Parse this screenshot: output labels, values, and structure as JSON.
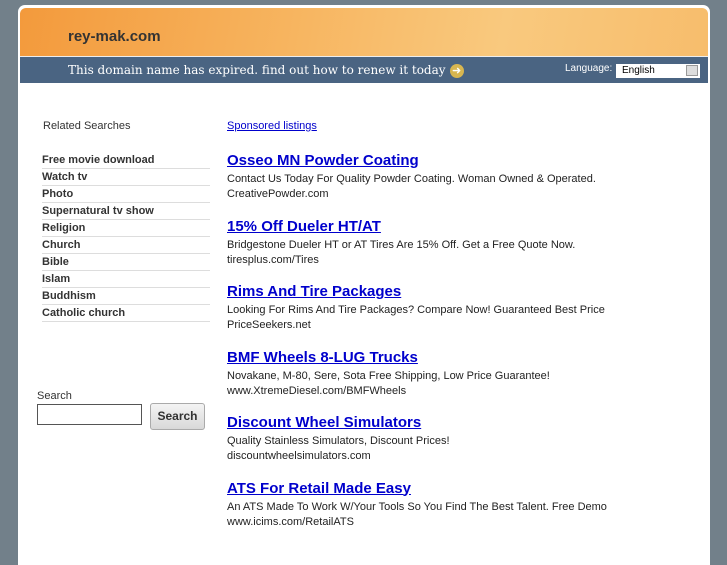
{
  "header": {
    "domain": "rey-mak.com",
    "expired_text": "This domain name has expired. find out how to renew it today",
    "language_label": "Language:",
    "language_value": "English"
  },
  "sidebar": {
    "title": "Related Searches",
    "items": [
      "Free movie download",
      "Watch tv",
      "Photo",
      "Supernatural tv show",
      "Religion",
      "Church",
      "Bible",
      "Islam",
      "Buddhism",
      "Catholic church"
    ],
    "search_label": "Search",
    "search_button": "Search",
    "search_value": ""
  },
  "main": {
    "sponsored": "Sponsored listings",
    "ads": [
      {
        "title": "Osseo MN Powder Coating",
        "desc": "Contact Us Today For Quality Powder Coating. Woman Owned & Operated.",
        "url": "CreativePowder.com"
      },
      {
        "title": "15% Off Dueler HT/AT",
        "desc": "Bridgestone Dueler HT or AT Tires Are 15% Off. Get a Free Quote Now.",
        "url": "tiresplus.com/Tires"
      },
      {
        "title": "Rims And Tire Packages",
        "desc": "Looking For Rims And Tire Packages? Compare Now! Guaranteed Best Price",
        "url": "PriceSeekers.net"
      },
      {
        "title": "BMF Wheels 8-LUG Trucks",
        "desc": "Novakane, M-80, Sere, Sota Free Shipping, Low Price Guarantee!",
        "url": "www.XtremeDiesel.com/BMFWheels"
      },
      {
        "title": "Discount Wheel Simulators",
        "desc": "Quality Stainless Simulators, Discount Prices!",
        "url": "discountwheelsimulators.com"
      },
      {
        "title": "ATS For Retail Made Easy",
        "desc": "An ATS Made To Work W/Your Tools So You Find The Best Talent. Free Demo",
        "url": "www.icims.com/RetailATS"
      }
    ]
  }
}
